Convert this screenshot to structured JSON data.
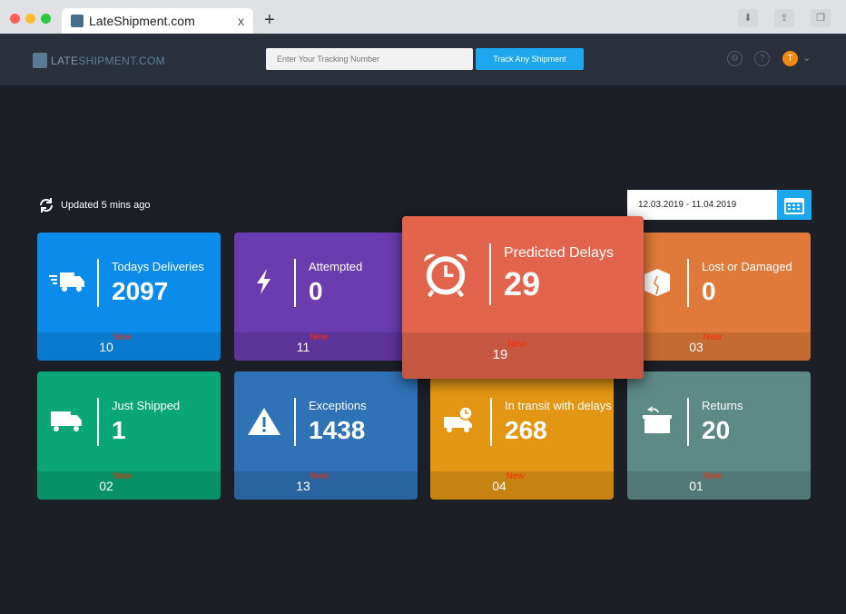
{
  "browser": {
    "tab_title": "LateShipment.com",
    "close": "x",
    "new_tab": "+"
  },
  "header": {
    "logo_late": "LATE",
    "logo_ship": "SHIPMENT.COM",
    "search_placeholder": "Enter Your Tracking Number",
    "track_label": "Track Any Shipment",
    "avatar_initial": "T"
  },
  "status": {
    "updated": "Updated 5 mins ago",
    "date_range": "12.03.2019 - 11.04.2019"
  },
  "new_label": "New",
  "cards": [
    {
      "label": "Todays Deliveries",
      "value": "2097",
      "new_count": "10",
      "color": "#0b8bea",
      "icon": "fast-delivery-truck-icon"
    },
    {
      "label": "Attempted",
      "value": "0",
      "new_count": "11",
      "color": "#6a3cb0",
      "icon": "lightning-icon"
    },
    {
      "label": "Predicted Delays",
      "value": "29",
      "new_count": "19",
      "color": "#e2644c",
      "icon": "alarm-clock-icon"
    },
    {
      "label": "Lost or Damaged",
      "value": "0",
      "new_count": "03",
      "color": "#e07a3a",
      "icon": "damaged-box-icon"
    },
    {
      "label": "Just Shipped",
      "value": "1",
      "new_count": "02",
      "color": "#0aa676",
      "icon": "truck-icon"
    },
    {
      "label": "Exceptions",
      "value": "1438",
      "new_count": "13",
      "color": "#2f72b6",
      "icon": "warning-icon"
    },
    {
      "label": "In transit with delays",
      "value": "268",
      "new_count": "04",
      "color": "#e39614",
      "icon": "truck-clock-icon"
    },
    {
      "label": "Returns",
      "value": "20",
      "new_count": "01",
      "color": "#5e8a86",
      "icon": "return-box-icon"
    }
  ]
}
